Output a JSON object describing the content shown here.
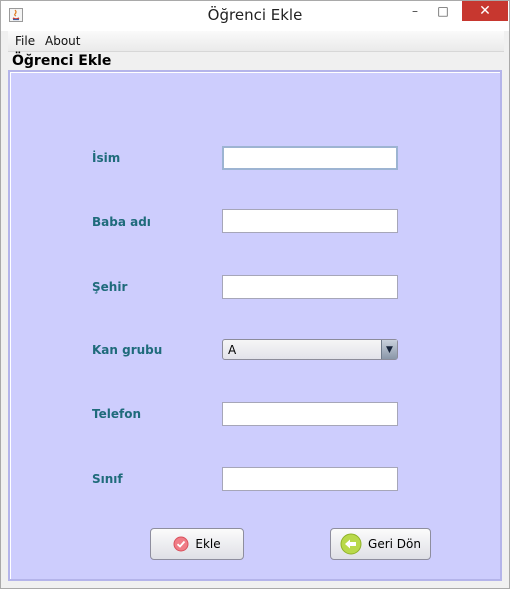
{
  "window": {
    "title": "Öğrenci Ekle",
    "controls": {
      "minimize": "–",
      "maximize": "□",
      "close": "✕"
    }
  },
  "menu": {
    "file": "File",
    "about": "About"
  },
  "panel": {
    "title": "Öğrenci Ekle",
    "background": "#cdcdfd"
  },
  "form": {
    "name_label": "İsim",
    "name_value": "",
    "father_label": "Baba adı",
    "father_value": "",
    "city_label": "Şehir",
    "city_value": "",
    "blood_label": "Kan grubu",
    "blood_selected": "A",
    "phone_label": "Telefon",
    "phone_value": "",
    "class_label": "Sınıf",
    "class_value": ""
  },
  "buttons": {
    "add_label": "Ekle",
    "add_icon": "checkmark-circle-icon",
    "back_label": "Geri Dön",
    "back_icon": "arrow-left-circle-icon"
  },
  "colors": {
    "label_text": "#1f6b7b",
    "panel_bg": "#cdcdfd",
    "close_button": "#c7372f"
  }
}
